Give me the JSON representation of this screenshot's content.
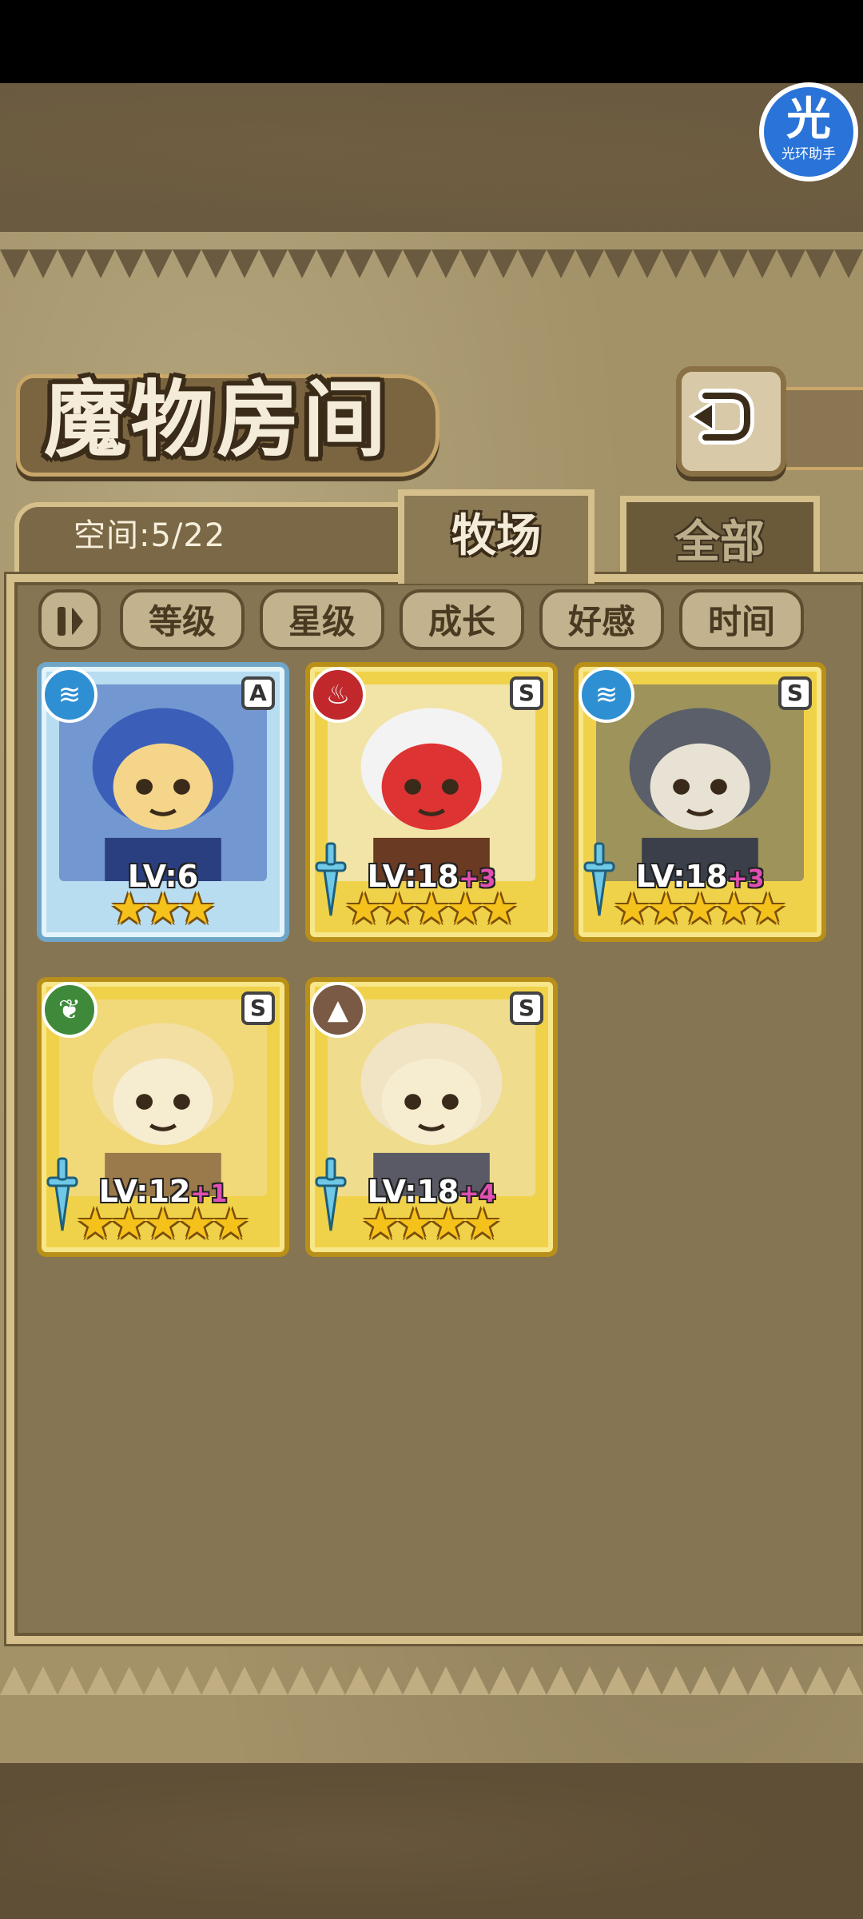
{
  "assistant_badge": {
    "glyph": "光",
    "label": "光环助手"
  },
  "header": {
    "title": "魔物房间",
    "back_icon": "return-arrow-icon"
  },
  "tabs": {
    "space_label": "空间:5/22",
    "ranch": "牧场",
    "all": "全部",
    "active": "ranch"
  },
  "sort": {
    "toggle_icon": "sort-order-icon",
    "buttons": [
      "等级",
      "星级",
      "成长",
      "好感",
      "时间"
    ]
  },
  "monsters": [
    {
      "element": "water",
      "element_icon": "water-waves-icon",
      "element_color": "#2f8fd3",
      "rank": "A",
      "frame": "blue",
      "level": "LV:6",
      "bonus": "",
      "stars": 3,
      "has_weapon": false
    },
    {
      "element": "fire",
      "element_icon": "flame-icon",
      "element_color": "#c0282c",
      "rank": "S",
      "frame": "gold",
      "level": "LV:18",
      "bonus": "+3",
      "stars": 5,
      "has_weapon": true
    },
    {
      "element": "water",
      "element_icon": "water-waves-icon",
      "element_color": "#2f8fd3",
      "rank": "S",
      "frame": "gold",
      "level": "LV:18",
      "bonus": "+3",
      "stars": 5,
      "has_weapon": true
    },
    {
      "element": "wind",
      "element_icon": "leaf-icon",
      "element_color": "#3e8a3a",
      "rank": "S",
      "frame": "gold",
      "level": "LV:12",
      "bonus": "+1",
      "stars": 5,
      "has_weapon": true
    },
    {
      "element": "earth",
      "element_icon": "mountain-icon",
      "element_color": "#7a5a44",
      "rank": "S",
      "frame": "gold",
      "level": "LV:18",
      "bonus": "+4",
      "stars": 4,
      "has_weapon": true
    }
  ]
}
